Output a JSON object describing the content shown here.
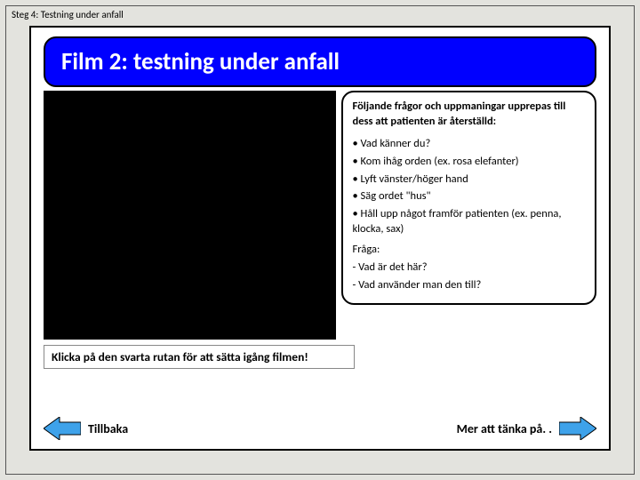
{
  "step_label": "Steg 4: Testning under anfall",
  "title": "Film 2: testning under anfall",
  "panel": {
    "intro": "Följande frågor och uppmaningar upprepas till dess att patienten är återställd:",
    "bullets": [
      "• Vad känner du?",
      "• Kom ihåg orden (ex. rosa elefanter)",
      "• Lyft vänster/höger hand",
      "• Säg ordet \"hus\"",
      "• Håll upp något framför patienten (ex. penna, klocka, sax)"
    ],
    "ask_label": "Fråga:",
    "ask_lines": [
      "- Vad är det här?",
      "- Vad använder man den till?"
    ]
  },
  "caption": "Klicka på den svarta rutan för att sätta igång filmen!",
  "nav": {
    "back": "Tillbaka",
    "forward": "Mer att tänka på. ."
  },
  "colors": {
    "title_bg": "#0000ff",
    "arrow_fill": "#3ea2ea"
  }
}
